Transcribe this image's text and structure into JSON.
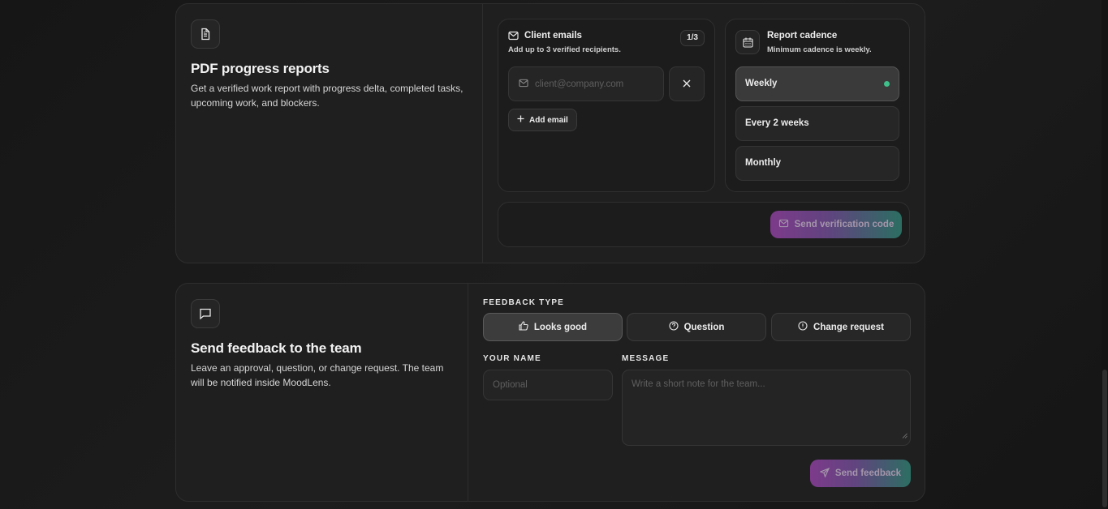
{
  "pdf_reports": {
    "icon": "document-icon",
    "title": "PDF progress reports",
    "description": "Get a verified work report with progress delta, completed tasks, upcoming work, and blockers.",
    "client_emails": {
      "title": "Client emails",
      "subtitle": "Add up to 3 verified recipients.",
      "count": "1/3",
      "email_placeholder": "client@company.com",
      "email_value": "",
      "add_label": "Add email"
    },
    "cadence": {
      "title": "Report cadence",
      "subtitle": "Minimum cadence is weekly.",
      "options": [
        {
          "label": "Weekly",
          "selected": true
        },
        {
          "label": "Every 2 weeks",
          "selected": false
        },
        {
          "label": "Monthly",
          "selected": false
        }
      ]
    },
    "send_code_label": "Send verification code"
  },
  "feedback": {
    "icon": "chat-bubble-icon",
    "title": "Send feedback to the team",
    "description": "Leave an approval, question, or change request. The team will be notified inside MoodLens.",
    "type_label": "FEEDBACK TYPE",
    "types": [
      {
        "label": "Looks good",
        "icon": "thumbs-up-icon",
        "active": true
      },
      {
        "label": "Question",
        "icon": "question-circle-icon",
        "active": false
      },
      {
        "label": "Change request",
        "icon": "alert-circle-icon",
        "active": false
      }
    ],
    "name_label": "YOUR NAME",
    "name_placeholder": "Optional",
    "message_label": "MESSAGE",
    "message_placeholder": "Write a short note for the team...",
    "send_label": "Send feedback"
  },
  "colors": {
    "accent_gradient_start": "#8a3f9a",
    "accent_gradient_end": "#2e7a6c",
    "selected_dot": "#3fbf8a"
  }
}
